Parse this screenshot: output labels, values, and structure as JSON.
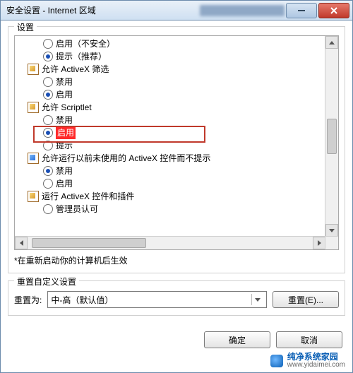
{
  "window": {
    "title": "安全设置 - Internet 区域"
  },
  "group_settings": {
    "label": "设置"
  },
  "tree": {
    "r1": {
      "label": "启用（不安全）",
      "checked": false
    },
    "r2": {
      "label": "提示（推荐）",
      "checked": true
    },
    "cat1": {
      "label": "允许 ActiveX 筛选"
    },
    "r3": {
      "label": "禁用",
      "checked": false
    },
    "r4": {
      "label": "启用",
      "checked": true
    },
    "cat2": {
      "label": "允许 Scriptlet"
    },
    "r5": {
      "label": "禁用",
      "checked": false
    },
    "r6": {
      "label": "启用",
      "checked": true
    },
    "r7": {
      "label": "提示",
      "checked": false
    },
    "cat3": {
      "label": "允许运行以前未使用的 ActiveX 控件而不提示"
    },
    "r8": {
      "label": "禁用",
      "checked": true
    },
    "r9": {
      "label": "启用",
      "checked": false
    },
    "cat4": {
      "label": "运行 ActiveX 控件和插件"
    },
    "r10": {
      "label": "管理员认可",
      "checked": false
    }
  },
  "note": "*在重新启动你的计算机后生效",
  "group_reset": {
    "label": "重置自定义设置",
    "reset_to": "重置为:",
    "dropdown_value": "中-高（默认值）",
    "reset_btn": "重置(E)..."
  },
  "buttons": {
    "ok": "确定",
    "cancel": "取消"
  },
  "watermark": {
    "name": "纯净系统家园",
    "url": "www.yidaimei.com"
  }
}
